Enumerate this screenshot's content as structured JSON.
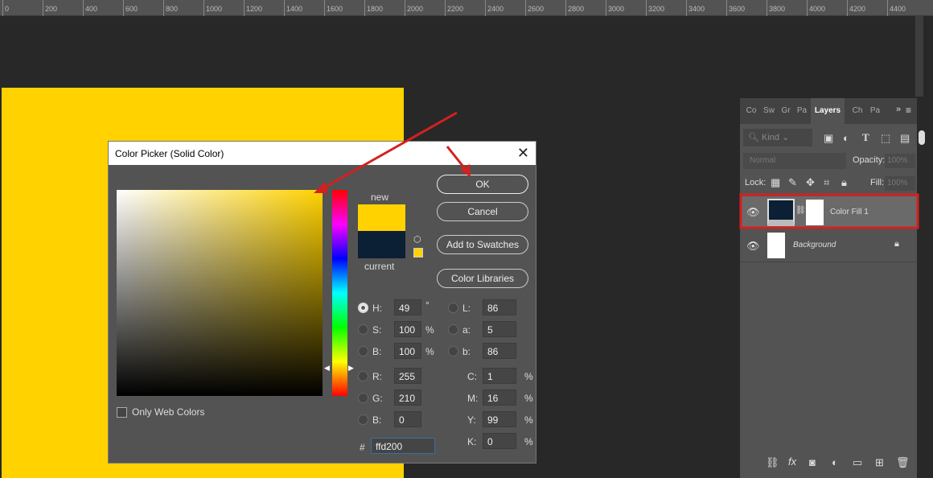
{
  "ruler": {
    "ticks": [
      "0",
      "200",
      "400",
      "600",
      "800",
      "1000",
      "1200",
      "1400",
      "1600",
      "1800",
      "2000",
      "2200",
      "2400",
      "2600",
      "2800",
      "3000",
      "3200",
      "3400",
      "3600",
      "3800",
      "4000",
      "4200",
      "4400"
    ]
  },
  "canvas_color": "#ffd200",
  "dialog": {
    "title": "Color Picker (Solid Color)",
    "new_label": "new",
    "current_label": "current",
    "new_color": "#ffd200",
    "current_color": "#0b1f35",
    "buttons": {
      "ok": "OK",
      "cancel": "Cancel",
      "add_swatches": "Add to Swatches",
      "color_libraries": "Color Libraries"
    },
    "only_web_colors": "Only Web Colors",
    "fields": {
      "H": {
        "label": "H:",
        "value": "49",
        "unit": "°"
      },
      "S": {
        "label": "S:",
        "value": "100",
        "unit": "%"
      },
      "Bv": {
        "label": "B:",
        "value": "100",
        "unit": "%"
      },
      "R": {
        "label": "R:",
        "value": "255"
      },
      "G": {
        "label": "G:",
        "value": "210"
      },
      "Bb": {
        "label": "B:",
        "value": "0"
      },
      "L": {
        "label": "L:",
        "value": "86"
      },
      "a": {
        "label": "a:",
        "value": "5"
      },
      "b": {
        "label": "b:",
        "value": "86"
      },
      "C": {
        "label": "C:",
        "value": "1",
        "unit": "%"
      },
      "M": {
        "label": "M:",
        "value": "16",
        "unit": "%"
      },
      "Y": {
        "label": "Y:",
        "value": "99",
        "unit": "%"
      },
      "K": {
        "label": "K:",
        "value": "0",
        "unit": "%"
      }
    },
    "hex_label": "#",
    "hex": "ffd200"
  },
  "layers_panel": {
    "tabs": [
      "Co",
      "Sw",
      "Gr",
      "Pa",
      "Layers",
      "Ch",
      "Pa"
    ],
    "active_tab": "Layers",
    "filter_placeholder": "Kind",
    "blend_mode": "Normal",
    "opacity_label": "Opacity:",
    "opacity": "100%",
    "lock_label": "Lock:",
    "fill_label": "Fill:",
    "fill": "100%",
    "layers": [
      {
        "name": "Color Fill 1",
        "selected": true
      },
      {
        "name": "Background",
        "locked": true
      }
    ]
  },
  "annotation_color": "#d42020"
}
